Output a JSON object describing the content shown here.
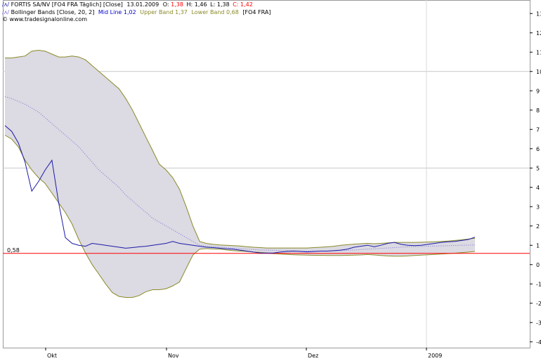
{
  "legend": {
    "line1": {
      "name": "FORTIS SA/NV [FO4 FRA  Täglich] [Close]",
      "date": "13.01.2009",
      "o_label": "O:",
      "o_value": "1,38",
      "h_label": "H:",
      "h_value": "1,46",
      "l_label": "L:",
      "l_value": "1,38",
      "c_label": "C:",
      "c_value": "1,42"
    },
    "line2": {
      "name": "Bollinger Bands [Close, 20, 2]",
      "mid_label": "Mid Line 1,02",
      "upper_label": "Upper Band 1,37",
      "lower_label": "Lower Band 0,68",
      "suffix": "[FO4 FRA]"
    },
    "line3": {
      "text": "www.tradesignalonline.com"
    }
  },
  "colors": {
    "price": "#1a1aa8",
    "mid": "#7a70d8",
    "band": "#8a8a2a",
    "fill": "#dcdae2",
    "hline": "#ff0000",
    "grid": "#c8c8c8",
    "o_value": "#ff0000",
    "c_value": "#ff0000",
    "mid_text": "#0000cc",
    "upper_text": "#8a8a2a",
    "lower_text": "#8a8a2a"
  },
  "chart_data": {
    "type": "line",
    "x_ticks": [
      "Okt",
      "Nov",
      "Dez",
      "2009"
    ],
    "y_ticks": [
      "13",
      "12",
      "11",
      "10",
      "9",
      "8",
      "7",
      "6",
      "5",
      "4",
      "3",
      "2",
      "1",
      "0",
      "-1",
      "-2",
      "-3",
      "-4"
    ],
    "ylim": [
      -4.3,
      13.7
    ],
    "horizontal_line": {
      "value": 0.58,
      "label": "0,58"
    },
    "series": [
      {
        "name": "FORTIS SA/NV [FO4 FRA  Täglich] [Close]",
        "values": [
          7.2,
          6.9,
          6.3,
          5.3,
          3.8,
          4.3,
          4.9,
          5.4,
          3.2,
          1.4,
          1.1,
          1.0,
          0.95,
          1.1,
          1.05,
          1.0,
          0.95,
          0.9,
          0.85,
          0.88,
          0.92,
          0.95,
          1.0,
          1.05,
          1.1,
          1.2,
          1.1,
          1.05,
          1.0,
          0.95,
          0.9,
          0.88,
          0.85,
          0.82,
          0.8,
          0.75,
          0.7,
          0.65,
          0.6,
          0.6,
          0.6,
          0.65,
          0.68,
          0.7,
          0.68,
          0.66,
          0.68,
          0.7,
          0.7,
          0.72,
          0.75,
          0.8,
          0.9,
          0.95,
          1.0,
          0.92,
          1.0,
          1.1,
          1.15,
          1.05,
          1.0,
          0.98,
          1.0,
          1.05,
          1.1,
          1.15,
          1.18,
          1.2,
          1.25,
          1.3,
          1.42
        ]
      },
      {
        "name": "Mid Line",
        "values": [
          8.7,
          8.6,
          8.45,
          8.3,
          8.1,
          7.9,
          7.6,
          7.3,
          7.0,
          6.7,
          6.4,
          6.1,
          5.7,
          5.3,
          4.9,
          4.6,
          4.3,
          4.0,
          3.6,
          3.3,
          3.0,
          2.7,
          2.4,
          2.2,
          2.0,
          1.8,
          1.6,
          1.4,
          1.2,
          1.0,
          0.95,
          0.93,
          0.9,
          0.88,
          0.85,
          0.83,
          0.8,
          0.78,
          0.76,
          0.75,
          0.74,
          0.73,
          0.72,
          0.71,
          0.7,
          0.7,
          0.7,
          0.7,
          0.7,
          0.71,
          0.72,
          0.74,
          0.76,
          0.78,
          0.8,
          0.82,
          0.84,
          0.86,
          0.88,
          0.9,
          0.92,
          0.93,
          0.94,
          0.95,
          0.96,
          0.97,
          0.98,
          0.99,
          1.0,
          1.01,
          1.02
        ]
      },
      {
        "name": "Upper Band",
        "values": [
          10.7,
          10.7,
          10.75,
          10.8,
          11.05,
          11.1,
          11.05,
          10.9,
          10.75,
          10.75,
          10.8,
          10.75,
          10.6,
          10.3,
          10.0,
          9.7,
          9.4,
          9.1,
          8.6,
          8.0,
          7.3,
          6.6,
          5.9,
          5.2,
          4.9,
          4.5,
          3.9,
          3.0,
          2.0,
          1.2,
          1.1,
          1.05,
          1.02,
          1.0,
          0.98,
          0.96,
          0.93,
          0.9,
          0.88,
          0.86,
          0.86,
          0.86,
          0.86,
          0.86,
          0.86,
          0.86,
          0.88,
          0.9,
          0.92,
          0.95,
          1.0,
          1.03,
          1.06,
          1.08,
          1.1,
          1.08,
          1.1,
          1.12,
          1.15,
          1.15,
          1.15,
          1.15,
          1.16,
          1.17,
          1.18,
          1.2,
          1.22,
          1.25,
          1.28,
          1.32,
          1.37
        ]
      },
      {
        "name": "Lower Band",
        "values": [
          6.7,
          6.5,
          6.1,
          5.4,
          4.9,
          4.5,
          4.2,
          3.7,
          3.2,
          2.7,
          2.1,
          1.3,
          0.6,
          0.0,
          -0.5,
          -1.0,
          -1.45,
          -1.65,
          -1.7,
          -1.7,
          -1.6,
          -1.4,
          -1.3,
          -1.3,
          -1.25,
          -1.1,
          -0.9,
          -0.2,
          0.5,
          0.8,
          0.83,
          0.81,
          0.8,
          0.76,
          0.72,
          0.7,
          0.68,
          0.65,
          0.63,
          0.6,
          0.57,
          0.55,
          0.53,
          0.51,
          0.5,
          0.49,
          0.48,
          0.48,
          0.47,
          0.47,
          0.47,
          0.48,
          0.49,
          0.5,
          0.52,
          0.5,
          0.47,
          0.45,
          0.44,
          0.44,
          0.45,
          0.47,
          0.49,
          0.51,
          0.53,
          0.55,
          0.57,
          0.59,
          0.62,
          0.65,
          0.68
        ]
      }
    ]
  }
}
